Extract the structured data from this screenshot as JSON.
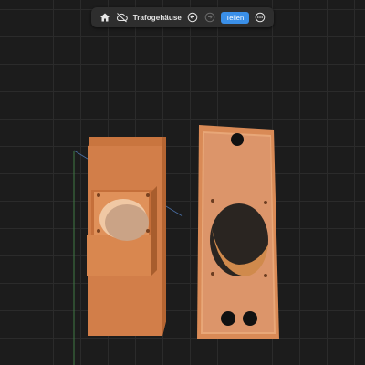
{
  "app": {
    "toolbar": {
      "home_icon": "home-icon",
      "cloud_icon": "cloud-off-icon",
      "title": "Trafogehäuse",
      "undo_icon": "undo-icon",
      "redo_icon": "redo-icon",
      "share_label": "Teilen",
      "more_icon": "more-icon"
    }
  },
  "colors": {
    "background": "#1c1c1c",
    "model": "#d9844f",
    "accent": "#3a8fe8"
  }
}
